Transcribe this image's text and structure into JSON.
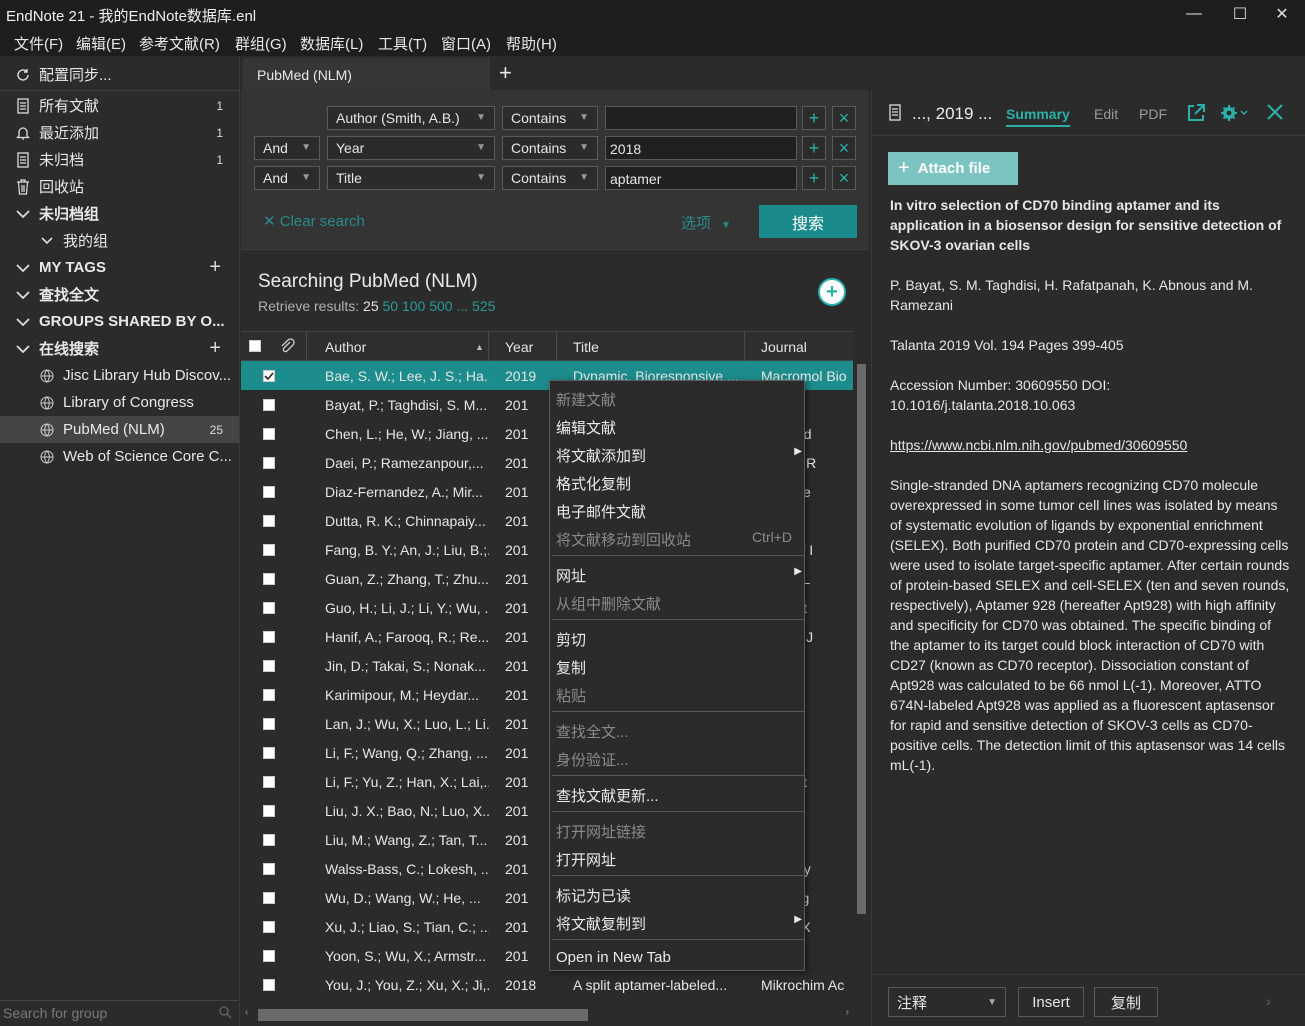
{
  "window": {
    "title": "EndNote 21 - 我的EndNote数据库.enl"
  },
  "menu": [
    "文件(F)",
    "编辑(E)",
    "参考文献(R)",
    "群组(G)",
    "数据库(L)",
    "工具(T)",
    "窗口(A)",
    "帮助(H)"
  ],
  "sidebar": {
    "sync": "配置同步...",
    "items": [
      {
        "label": "所有文献",
        "count": "1"
      },
      {
        "label": "最近添加",
        "count": "1"
      },
      {
        "label": "未归档",
        "count": "1"
      },
      {
        "label": "回收站",
        "count": ""
      }
    ],
    "unfiled_group": "未归档组",
    "my_groups": "我的组",
    "my_tags": "MY TAGS",
    "find_full_text": "查找全文",
    "groups_shared": "GROUPS SHARED BY O...",
    "online_search": "在线搜索",
    "online": [
      {
        "label": "Jisc Library Hub Discov...",
        "count": ""
      },
      {
        "label": "Library of Congress",
        "count": ""
      },
      {
        "label": "PubMed (NLM)",
        "count": "25"
      },
      {
        "label": "Web of Science Core C...",
        "count": ""
      }
    ],
    "search_placeholder": "Search for group"
  },
  "tab": {
    "label": "PubMed (NLM)",
    "add": "+"
  },
  "search": {
    "rows": [
      {
        "bool": "",
        "field": "Author (Smith, A.B.)",
        "op": "Contains",
        "value": ""
      },
      {
        "bool": "And",
        "field": "Year",
        "op": "Contains",
        "value": "2018"
      },
      {
        "bool": "And",
        "field": "Title",
        "op": "Contains",
        "value": "aptamer"
      }
    ],
    "clear": "Clear search",
    "options": "选项",
    "button": "搜索"
  },
  "results": {
    "heading": "Searching PubMed (NLM)",
    "retrieve_label": "Retrieve results:",
    "current": "25",
    "links": [
      "50",
      "100",
      "500",
      "...",
      "525"
    ]
  },
  "columns": {
    "author": "Author",
    "year": "Year",
    "title": "Title",
    "journal": "Journal"
  },
  "table": [
    {
      "author": "Bae, S. W.; Lee, J. S.; Ha...",
      "year": "2019",
      "title": "Dynamic, Bioresponsive ...",
      "journal": "Macromol Bio",
      "selected": true
    },
    {
      "author": "Bayat, P.; Taghdisi, S. M...",
      "year": "201",
      "title": "",
      "journal": "a"
    },
    {
      "author": "Chen, L.; He, W.; Jiang, ...",
      "year": "201",
      "title": "",
      "journal": "anomed"
    },
    {
      "author": "Daei, P.; Ramezanpour,...",
      "year": "201",
      "title": "",
      "journal": "Pharm R"
    },
    {
      "author": "Diaz-Fernandez, A.; Mir...",
      "year": "201",
      "title": "",
      "journal": "s Bioele"
    },
    {
      "author": "Dutta, R. K.; Chinnapaiy...",
      "year": "201",
      "title": "",
      "journal": "er"
    },
    {
      "author": "Fang, B. Y.; An, J.; Liu, B.;...",
      "year": "201",
      "title": "",
      "journal": "ds Surf I"
    },
    {
      "author": "Guan, Z.; Zhang, T.; Zhu...",
      "year": "201",
      "title": "",
      "journal": "Chem L"
    },
    {
      "author": "Guo, H.; Li, J.; Li, Y.; Wu, ...",
      "year": "201",
      "title": "",
      "journal": "him Act"
    },
    {
      "author": "Hanif, A.; Farooq, R.; Re...",
      "year": "201",
      "title": "",
      "journal": "Pharm J"
    },
    {
      "author": "Jin, D.; Takai, S.; Nonak...",
      "year": "201",
      "title": "",
      "journal": "er Nucl"
    },
    {
      "author": "Karimipour, M.; Heydar...",
      "year": "201",
      "title": "",
      "journal": "him Ac"
    },
    {
      "author": "Lan, J.; Wu, X.; Luo, L.; Li...",
      "year": "201",
      "title": "",
      "journal": "a"
    },
    {
      "author": "Li, F.; Wang, Q.; Zhang, ...",
      "year": "201",
      "title": "",
      "journal": "ysiol Bi"
    },
    {
      "author": "Li, F.; Yu, Z.; Han, X.; Lai,...",
      "year": "201",
      "title": "",
      "journal": "him Act"
    },
    {
      "author": "Liu, J. X.; Bao, N.; Luo, X...",
      "year": "201",
      "title": "",
      "journal": "mega"
    },
    {
      "author": "Liu, M.; Wang, Z.; Tan, T...",
      "year": "201",
      "title": "",
      "journal": "ostics"
    },
    {
      "author": "Walss-Bass, C.; Lokesh, ...",
      "year": "201",
      "title": "",
      "journal": "europsy"
    },
    {
      "author": "Wu, D.; Wang, W.; He, ...",
      "year": "201",
      "title": "",
      "journal": "Sci Eng"
    },
    {
      "author": "Xu, J.; Liao, S.; Tian, C.; ...",
      "year": "201",
      "title": "",
      "journal": "Wu Yi X"
    },
    {
      "author": "Yoon, S.; Wu, X.; Armstr...",
      "year": "201",
      "title": "",
      "journal": "er Nucl"
    },
    {
      "author": "You, J.; You, Z.; Xu, X.; Ji,...",
      "year": "2018",
      "title": "A split aptamer-labeled...",
      "journal": "Mikrochim Ac"
    }
  ],
  "context_menu": {
    "new_ref": "新建文献",
    "edit_ref": "编辑文献",
    "add_to": "将文献添加到",
    "copy_formatted": "格式化复制",
    "email_ref": "电子邮件文献",
    "move_trash": "将文献移动到回收站",
    "move_trash_shortcut": "Ctrl+D",
    "url": "网址",
    "remove_from_group": "从组中删除文献",
    "cut": "剪切",
    "copy": "复制",
    "paste": "粘贴",
    "find_full_text": "查找全文...",
    "authenticate": "身份验证...",
    "find_updates": "查找文献更新...",
    "open_url_link": "打开网址链接",
    "open_url": "打开网址",
    "mark_read": "标记为已读",
    "copy_ref_to": "将文献复制到",
    "open_new_tab": "Open in New Tab"
  },
  "reference_panel": {
    "ref_short": "..., 2019 ...",
    "tabs": {
      "summary": "Summary",
      "edit": "Edit",
      "pdf": "PDF"
    },
    "attach": "Attach file",
    "title": "In vitro selection of CD70 binding aptamer and its application in a biosensor design for sensitive detection of SKOV-3 ovarian cells",
    "authors": "P. Bayat, S. M. Taghdisi, H. Rafatpanah, K. Abnous and M. Ramezani",
    "citation": "Talanta 2019 Vol. 194 Pages 399-405",
    "accession": "Accession Number: 30609550 DOI: 10.1016/j.talanta.2018.10.063",
    "url": "https://www.ncbi.nlm.nih.gov/pubmed/30609550",
    "abstract": "Single-stranded DNA aptamers recognizing CD70 molecule overexpressed in some tumor cell lines was isolated by means of systematic evolution of ligands by exponential enrichment (SELEX). Both purified CD70 protein and CD70-expressing cells were used to isolate target-specific aptamer. After certain rounds of protein-based SELEX and cell-SELEX (ten and seven rounds, respectively), Aptamer 928 (hereafter Apt928) with high affinity and specificity for CD70 was obtained. The specific binding of the aptamer to its target could block interaction of CD70 with CD27 (known as CD70 receptor). Dissociation constant of Apt928 was calculated to be 66 nmol L(-1). Moreover, ATTO 674N-labeled Apt928 was applied as a fluorescent aptasensor for rapid and sensitive detection of SKOV-3 cells as CD70-positive cells. The detection limit of this aptasensor was 14 cells mL(-1).",
    "bottom": {
      "annotation": "注释",
      "insert": "Insert",
      "copy": "复制"
    }
  },
  "colors": {
    "accent": "#2ab0a8",
    "selected_row": "#1c8c8c",
    "search_button": "#1b8a8a"
  }
}
